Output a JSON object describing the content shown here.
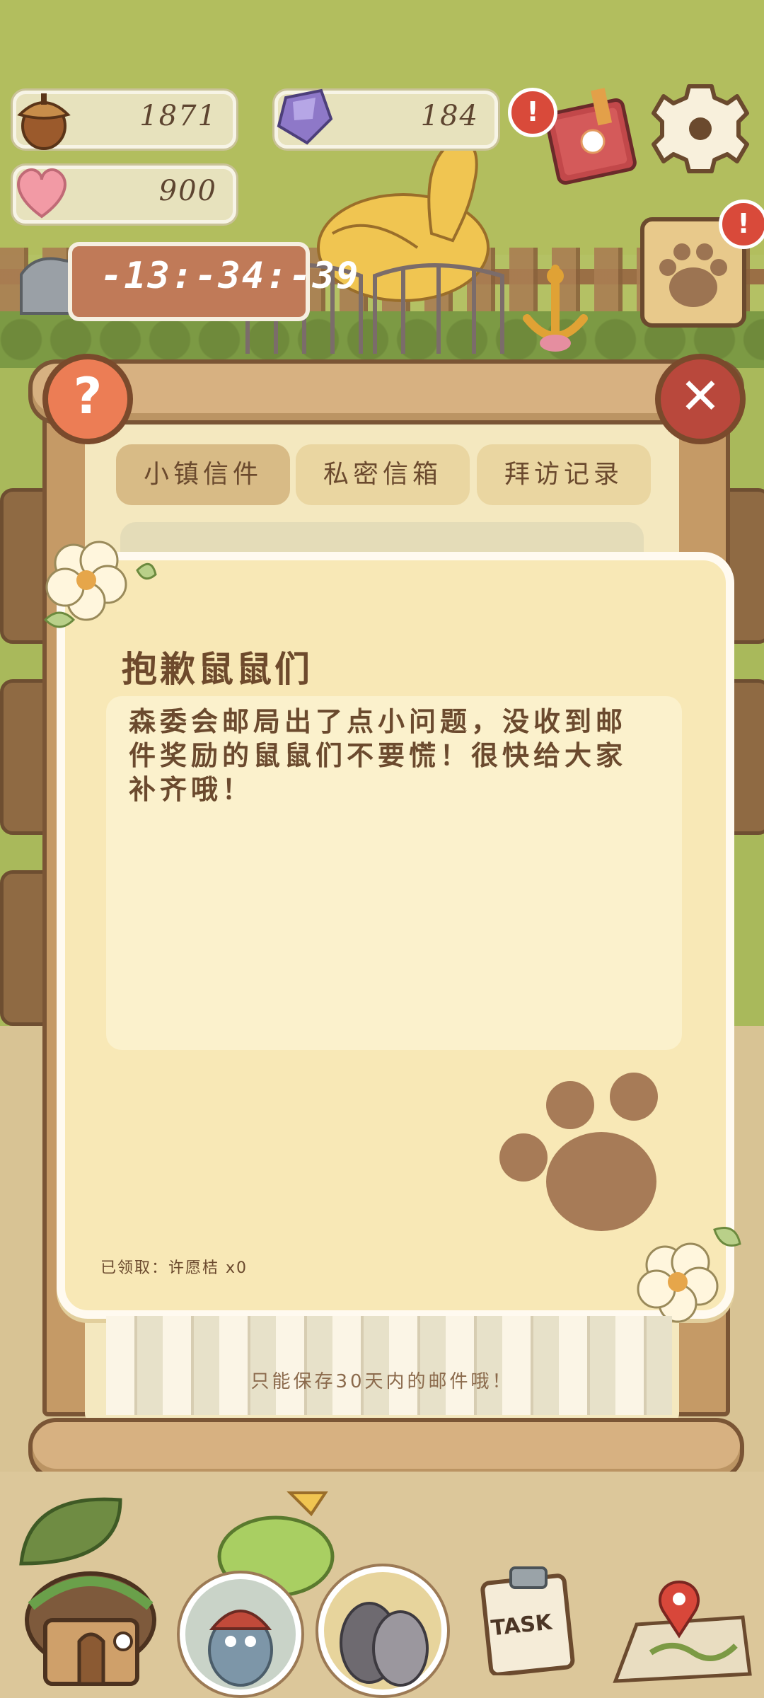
{
  "resources": {
    "acorns": "1871",
    "gems": "184",
    "hearts": "900",
    "timer": "-13:-34:-39"
  },
  "notifications": {
    "book_badge": "!",
    "paw_badge": "!"
  },
  "tabs": [
    {
      "label": "小镇信件",
      "active": true
    },
    {
      "label": "私密信箱",
      "active": false
    },
    {
      "label": "拜访记录",
      "active": false
    }
  ],
  "letter": {
    "title": "抱歉鼠鼠们",
    "body": "森委会邮局出了点小问题，没收到邮件奖励的鼠鼠们不要慌！很快给大家补齐哦！",
    "claimed": "已领取：许愿桔 x0"
  },
  "footer_note": "只能保存30天内的邮件哦！",
  "buttons": {
    "help": "?",
    "close": "✕"
  },
  "bottom_nav": {
    "task_label": "TASK"
  },
  "colors": {
    "accent_orange": "#e8754f",
    "close_red": "#b9483c",
    "badge_red": "#d94a3a",
    "card_bg": "#f8e8b6",
    "wood": "#c59a66",
    "grass": "#b4c164"
  },
  "icons": [
    "acorn-icon",
    "gem-icon",
    "heart-icon",
    "book-icon",
    "gear-icon",
    "paw-icon",
    "help-icon",
    "close-icon",
    "house-icon",
    "map-icon",
    "task-clipboard-icon"
  ]
}
